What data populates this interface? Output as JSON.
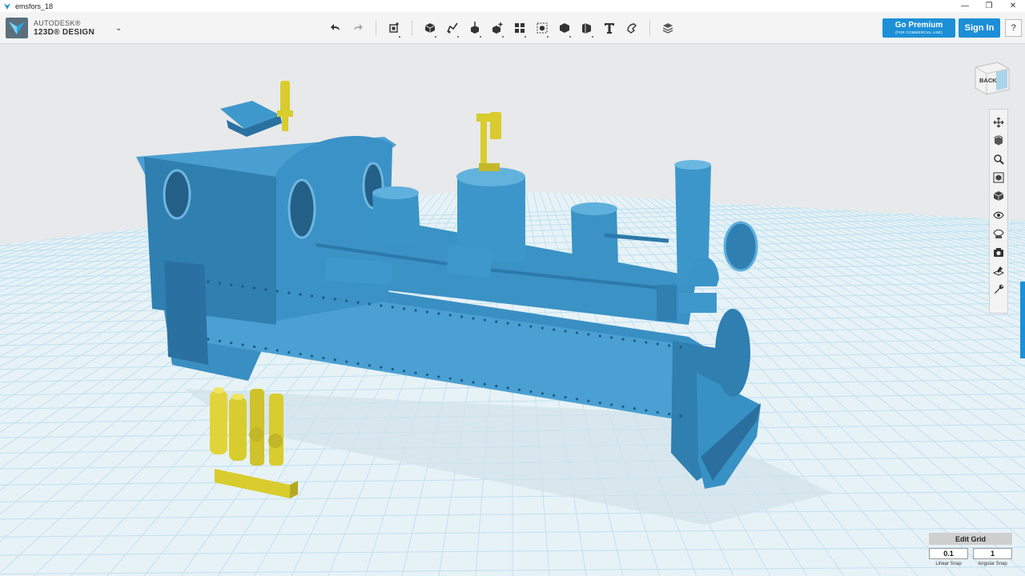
{
  "window": {
    "title": "emsfors_18",
    "controls": {
      "minimize": "—",
      "maximize": "❐",
      "close": "✕"
    }
  },
  "header": {
    "logo_brand": "AUTODESK®",
    "logo_product": "123D® DESIGN",
    "menu_caret": "⌄",
    "go_premium": "Go Premium",
    "go_premium_sub": "(FOR COMMERCIAL USE)",
    "sign_in": "Sign In",
    "help": "?"
  },
  "toolbar": {
    "icons": [
      "undo-icon",
      "redo-icon",
      "transform-icon",
      "primitives-icon",
      "sketch-icon",
      "construct-icon",
      "modify-icon",
      "pattern-icon",
      "grouping-icon",
      "combine-icon",
      "measure-icon",
      "text-icon",
      "snap-icon",
      "material-icon"
    ]
  },
  "viewcube": {
    "face_label": "BACK"
  },
  "navbar": {
    "icons": [
      "pan-icon",
      "orbit-icon",
      "zoom-icon",
      "fit-icon",
      "view-mode-icon",
      "visibility-icon",
      "material-visibility-icon",
      "snapshot-icon",
      "grid-icon",
      "wrench-icon"
    ]
  },
  "grid_panel": {
    "title": "Edit Grid",
    "linear_value": "0.1",
    "angular_value": "1",
    "linear_label": "Linear Snap",
    "angular_label": "Angular Snap"
  },
  "colors": {
    "accent": "#1d8fd6",
    "model_blue": "#3a93c6",
    "model_yellow": "#d8cc2e",
    "grid_line": "#bfe1ef"
  }
}
